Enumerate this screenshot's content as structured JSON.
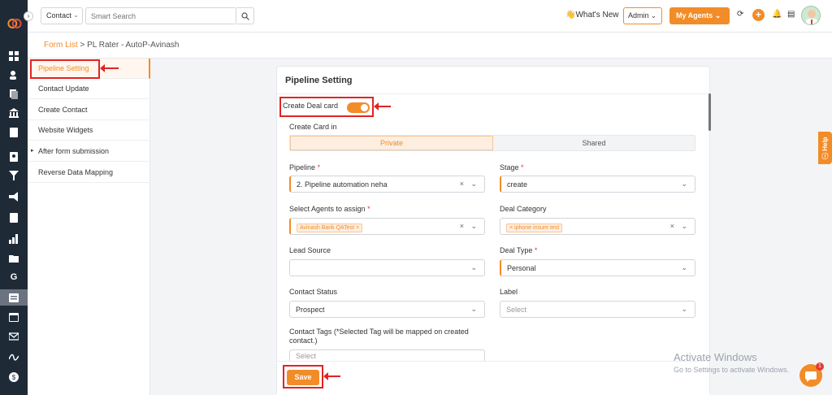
{
  "topbar": {
    "entity_select": "Contact",
    "search_placeholder": "Smart Search",
    "whats_new": "What's New",
    "admin": "Admin",
    "my_agents": "My Agents"
  },
  "breadcrumb": {
    "link": "Form List",
    "separator": ">",
    "current": "PL Rater - AutoP-Avinash"
  },
  "left_menu": [
    {
      "label": "Pipeline Setting",
      "active": true
    },
    {
      "label": "Contact Update"
    },
    {
      "label": "Create Contact"
    },
    {
      "label": "Website Widgets"
    },
    {
      "label": "After form submission",
      "has_arrow": true
    },
    {
      "label": "Reverse Data Mapping"
    }
  ],
  "card": {
    "title": "Pipeline Setting",
    "create_deal_label": "Create Deal card",
    "create_deal_on": true,
    "create_card_in_label": "Create Card in",
    "segment": {
      "private": "Private",
      "shared": "Shared",
      "selected": "Private"
    },
    "pipeline": {
      "label": "Pipeline",
      "value": "2. Pipeline automation neha"
    },
    "stage": {
      "label": "Stage",
      "value": "create"
    },
    "agents": {
      "label": "Select Agents to assign",
      "chip": "Avinash Barik QATest"
    },
    "deal_category": {
      "label": "Deal Category",
      "chip": "iphone insure test"
    },
    "lead_source": {
      "label": "Lead Source",
      "value": ""
    },
    "deal_type": {
      "label": "Deal Type",
      "value": "Personal"
    },
    "contact_status": {
      "label": "Contact Status",
      "value": "Prospect"
    },
    "label_field": {
      "label": "Label",
      "placeholder": "Select"
    },
    "contact_tags": {
      "label": "Contact Tags (*Selected Tag will be mapped on created contact.)",
      "placeholder": "Select"
    },
    "save": "Save"
  },
  "help_tab": "Help",
  "watermark": {
    "line1": "Activate Windows",
    "line2": "Go to Settings to activate Windows."
  },
  "chat_badge": "1",
  "colors": {
    "accent": "#f28c28",
    "annotation": "#e02424",
    "rail": "#1f2a37"
  }
}
